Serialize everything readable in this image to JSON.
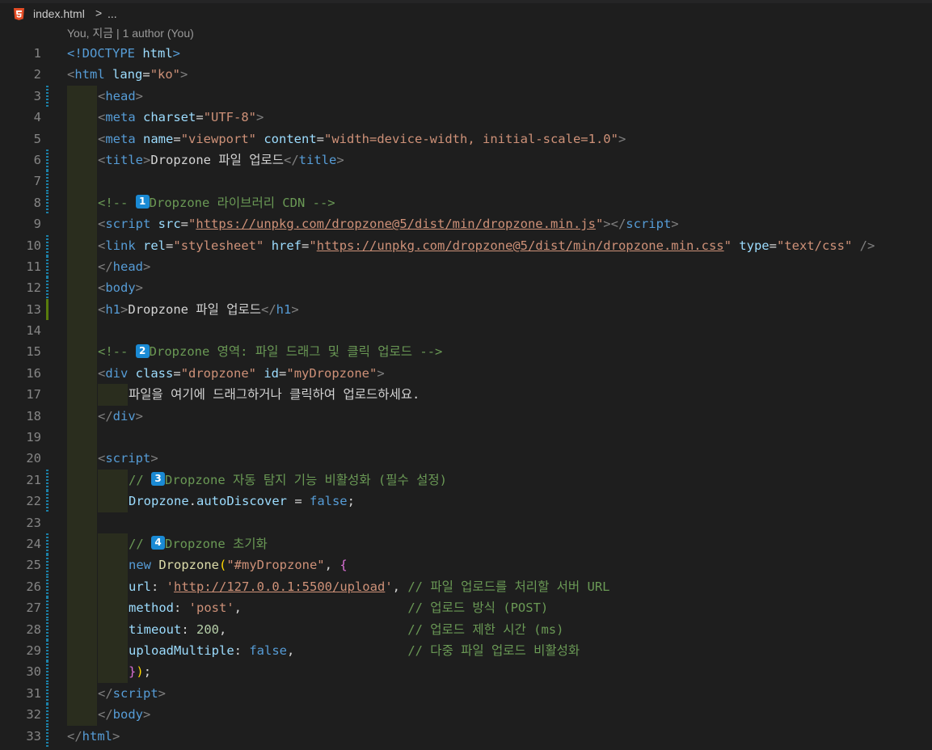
{
  "breadcrumb": {
    "file": "index.html",
    "separator": ">",
    "more": "..."
  },
  "codelens": "You, 지금 | 1 author (You)",
  "colors": {
    "background": "#1e1e1e",
    "tag": "#569cd6",
    "attribute": "#9cdcfe",
    "string": "#ce9178",
    "comment": "#6a9955",
    "html_icon": "#e44d26",
    "badge": "#1a8ad4"
  },
  "icons": {
    "file_type": "html5-icon"
  },
  "lines": [
    {
      "n": "1",
      "gutter": "",
      "indent": 0,
      "tokens": [
        [
          "c-tag",
          "<!DOCTYPE "
        ],
        [
          "c-attr",
          "html"
        ],
        [
          "c-tag",
          ">"
        ]
      ]
    },
    {
      "n": "2",
      "gutter": "",
      "indent": 0,
      "tokens": [
        [
          "c-punc",
          "<"
        ],
        [
          "c-tag",
          "html "
        ],
        [
          "c-attr",
          "lang"
        ],
        [
          "c-text",
          "="
        ],
        [
          "c-str",
          "\"ko\""
        ],
        [
          "c-punc",
          ">"
        ]
      ]
    },
    {
      "n": "3",
      "gutter": "mod",
      "indent": 1,
      "tokens": [
        [
          "c-punc",
          "<"
        ],
        [
          "c-tag",
          "head"
        ],
        [
          "c-punc",
          ">"
        ]
      ]
    },
    {
      "n": "4",
      "gutter": "",
      "indent": 1,
      "tokens": [
        [
          "c-punc",
          "<"
        ],
        [
          "c-tag",
          "meta "
        ],
        [
          "c-attr",
          "charset"
        ],
        [
          "c-text",
          "="
        ],
        [
          "c-str",
          "\"UTF-8\""
        ],
        [
          "c-punc",
          ">"
        ]
      ]
    },
    {
      "n": "5",
      "gutter": "",
      "indent": 1,
      "tokens": [
        [
          "c-punc",
          "<"
        ],
        [
          "c-tag",
          "meta "
        ],
        [
          "c-attr",
          "name"
        ],
        [
          "c-text",
          "="
        ],
        [
          "c-str",
          "\"viewport\" "
        ],
        [
          "c-attr",
          "content"
        ],
        [
          "c-text",
          "="
        ],
        [
          "c-str",
          "\"width=device-width, initial-scale=1.0\""
        ],
        [
          "c-punc",
          ">"
        ]
      ]
    },
    {
      "n": "6",
      "gutter": "mod",
      "indent": 1,
      "tokens": [
        [
          "c-punc",
          "<"
        ],
        [
          "c-tag",
          "title"
        ],
        [
          "c-punc",
          ">"
        ],
        [
          "c-text",
          "Dropzone 파일 업로드"
        ],
        [
          "c-punc",
          "</"
        ],
        [
          "c-tag",
          "title"
        ],
        [
          "c-punc",
          ">"
        ]
      ]
    },
    {
      "n": "7",
      "gutter": "mod",
      "indent": 1,
      "tokens": []
    },
    {
      "n": "8",
      "gutter": "mod",
      "indent": 1,
      "tokens": [
        [
          "c-comment",
          "<!-- "
        ],
        [
          "badge",
          "1"
        ],
        [
          "c-comment",
          "Dropzone 라이브러리 CDN -->"
        ]
      ]
    },
    {
      "n": "9",
      "gutter": "",
      "indent": 1,
      "tokens": [
        [
          "c-punc",
          "<"
        ],
        [
          "c-tag",
          "script "
        ],
        [
          "c-attr",
          "src"
        ],
        [
          "c-text",
          "="
        ],
        [
          "c-str",
          "\""
        ],
        [
          "c-url",
          "https://unpkg.com/dropzone@5/dist/min/dropzone.min.js"
        ],
        [
          "c-str",
          "\""
        ],
        [
          "c-punc",
          "></"
        ],
        [
          "c-tag",
          "script"
        ],
        [
          "c-punc",
          ">"
        ]
      ]
    },
    {
      "n": "10",
      "gutter": "mod",
      "indent": 1,
      "tokens": [
        [
          "c-punc",
          "<"
        ],
        [
          "c-tag",
          "link "
        ],
        [
          "c-attr",
          "rel"
        ],
        [
          "c-text",
          "="
        ],
        [
          "c-str",
          "\"stylesheet\" "
        ],
        [
          "c-attr",
          "href"
        ],
        [
          "c-text",
          "="
        ],
        [
          "c-str",
          "\""
        ],
        [
          "c-url",
          "https://unpkg.com/dropzone@5/dist/min/dropzone.min.css"
        ],
        [
          "c-str",
          "\" "
        ],
        [
          "c-attr",
          "type"
        ],
        [
          "c-text",
          "="
        ],
        [
          "c-str",
          "\"text/css\" "
        ],
        [
          "c-punc",
          "/>"
        ]
      ]
    },
    {
      "n": "11",
      "gutter": "mod",
      "indent": 1,
      "tokens": [
        [
          "c-punc",
          "</"
        ],
        [
          "c-tag",
          "head"
        ],
        [
          "c-punc",
          ">"
        ]
      ]
    },
    {
      "n": "12",
      "gutter": "mod",
      "indent": 1,
      "tokens": [
        [
          "c-punc",
          "<"
        ],
        [
          "c-tag",
          "body"
        ],
        [
          "c-punc",
          ">"
        ]
      ]
    },
    {
      "n": "13",
      "gutter": "add",
      "indent": 1,
      "tokens": [
        [
          "c-punc",
          "<"
        ],
        [
          "c-tag",
          "h1"
        ],
        [
          "c-punc",
          ">"
        ],
        [
          "c-text",
          "Dropzone 파일 업로드"
        ],
        [
          "c-punc",
          "</"
        ],
        [
          "c-tag",
          "h1"
        ],
        [
          "c-punc",
          ">"
        ]
      ]
    },
    {
      "n": "14",
      "gutter": "",
      "indent": 1,
      "tokens": []
    },
    {
      "n": "15",
      "gutter": "",
      "indent": 1,
      "tokens": [
        [
          "c-comment",
          "<!-- "
        ],
        [
          "badge",
          "2"
        ],
        [
          "c-comment",
          "Dropzone 영역: 파일 드래그 및 클릭 업로드 -->"
        ]
      ]
    },
    {
      "n": "16",
      "gutter": "",
      "indent": 1,
      "tokens": [
        [
          "c-punc",
          "<"
        ],
        [
          "c-tag",
          "div "
        ],
        [
          "c-attr",
          "class"
        ],
        [
          "c-text",
          "="
        ],
        [
          "c-str",
          "\"dropzone\" "
        ],
        [
          "c-attr",
          "id"
        ],
        [
          "c-text",
          "="
        ],
        [
          "c-str",
          "\"myDropzone\""
        ],
        [
          "c-punc",
          ">"
        ]
      ]
    },
    {
      "n": "17",
      "gutter": "",
      "indent": 2,
      "tokens": [
        [
          "c-text",
          "파일을 여기에 드래그하거나 클릭하여 업로드하세요."
        ]
      ]
    },
    {
      "n": "18",
      "gutter": "",
      "indent": 1,
      "tokens": [
        [
          "c-punc",
          "</"
        ],
        [
          "c-tag",
          "div"
        ],
        [
          "c-punc",
          ">"
        ]
      ]
    },
    {
      "n": "19",
      "gutter": "",
      "indent": 1,
      "tokens": []
    },
    {
      "n": "20",
      "gutter": "",
      "indent": 1,
      "tokens": [
        [
          "c-punc",
          "<"
        ],
        [
          "c-tag",
          "script"
        ],
        [
          "c-punc",
          ">"
        ]
      ]
    },
    {
      "n": "21",
      "gutter": "mod",
      "indent": 2,
      "tokens": [
        [
          "c-comment",
          "// "
        ],
        [
          "badge",
          "3"
        ],
        [
          "c-comment",
          "Dropzone 자동 탐지 기능 비활성화 (필수 설정)"
        ]
      ]
    },
    {
      "n": "22",
      "gutter": "mod",
      "indent": 2,
      "tokens": [
        [
          "c-prop",
          "Dropzone"
        ],
        [
          "c-text",
          "."
        ],
        [
          "c-prop",
          "autoDiscover"
        ],
        [
          "c-text",
          " = "
        ],
        [
          "c-kw",
          "false"
        ],
        [
          "c-text",
          ";"
        ]
      ]
    },
    {
      "n": "23",
      "gutter": "",
      "indent": 1,
      "tokens": []
    },
    {
      "n": "24",
      "gutter": "mod",
      "indent": 2,
      "tokens": [
        [
          "c-comment",
          "// "
        ],
        [
          "badge",
          "4"
        ],
        [
          "c-comment",
          "Dropzone 초기화"
        ]
      ]
    },
    {
      "n": "25",
      "gutter": "mod",
      "indent": 2,
      "tokens": [
        [
          "c-kw",
          "new "
        ],
        [
          "c-fn",
          "Dropzone"
        ],
        [
          "c-br2",
          "("
        ],
        [
          "c-str",
          "\"#myDropzone\""
        ],
        [
          "c-text",
          ", "
        ],
        [
          "c-br1",
          "{"
        ]
      ]
    },
    {
      "n": "26",
      "gutter": "mod",
      "indent": 2,
      "tokens": [
        [
          "c-prop",
          "url"
        ],
        [
          "c-text",
          ": "
        ],
        [
          "c-str",
          "'"
        ],
        [
          "c-url",
          "http://127.0.0.1:5500/upload"
        ],
        [
          "c-str",
          "'"
        ],
        [
          "c-text",
          ", "
        ],
        [
          "c-comment",
          "// 파일 업로드를 처리할 서버 URL"
        ]
      ]
    },
    {
      "n": "27",
      "gutter": "mod",
      "indent": 2,
      "tokens": [
        [
          "c-prop",
          "method"
        ],
        [
          "c-text",
          ": "
        ],
        [
          "c-str",
          "'post'"
        ],
        [
          "c-text",
          ",                      "
        ],
        [
          "c-comment",
          "// 업로드 방식 (POST)"
        ]
      ]
    },
    {
      "n": "28",
      "gutter": "mod",
      "indent": 2,
      "tokens": [
        [
          "c-prop",
          "timeout"
        ],
        [
          "c-text",
          ": "
        ],
        [
          "c-num",
          "200"
        ],
        [
          "c-text",
          ",                        "
        ],
        [
          "c-comment",
          "// 업로드 제한 시간 (ms)"
        ]
      ]
    },
    {
      "n": "29",
      "gutter": "mod",
      "indent": 2,
      "tokens": [
        [
          "c-prop",
          "uploadMultiple"
        ],
        [
          "c-text",
          ": "
        ],
        [
          "c-kw",
          "false"
        ],
        [
          "c-text",
          ",               "
        ],
        [
          "c-comment",
          "// 다중 파일 업로드 비활성화"
        ]
      ]
    },
    {
      "n": "30",
      "gutter": "mod",
      "indent": 2,
      "tokens": [
        [
          "c-br1",
          "}"
        ],
        [
          "c-br2",
          ")"
        ],
        [
          "c-text",
          ";"
        ]
      ]
    },
    {
      "n": "31",
      "gutter": "mod",
      "indent": 1,
      "tokens": [
        [
          "c-punc",
          "</"
        ],
        [
          "c-tag",
          "script"
        ],
        [
          "c-punc",
          ">"
        ]
      ]
    },
    {
      "n": "32",
      "gutter": "mod",
      "indent": 1,
      "tokens": [
        [
          "c-punc",
          "</"
        ],
        [
          "c-tag",
          "body"
        ],
        [
          "c-punc",
          ">"
        ]
      ]
    },
    {
      "n": "33",
      "gutter": "mod",
      "indent": 0,
      "tokens": [
        [
          "c-punc",
          "</"
        ],
        [
          "c-tag",
          "html"
        ],
        [
          "c-punc",
          ">"
        ]
      ]
    }
  ]
}
